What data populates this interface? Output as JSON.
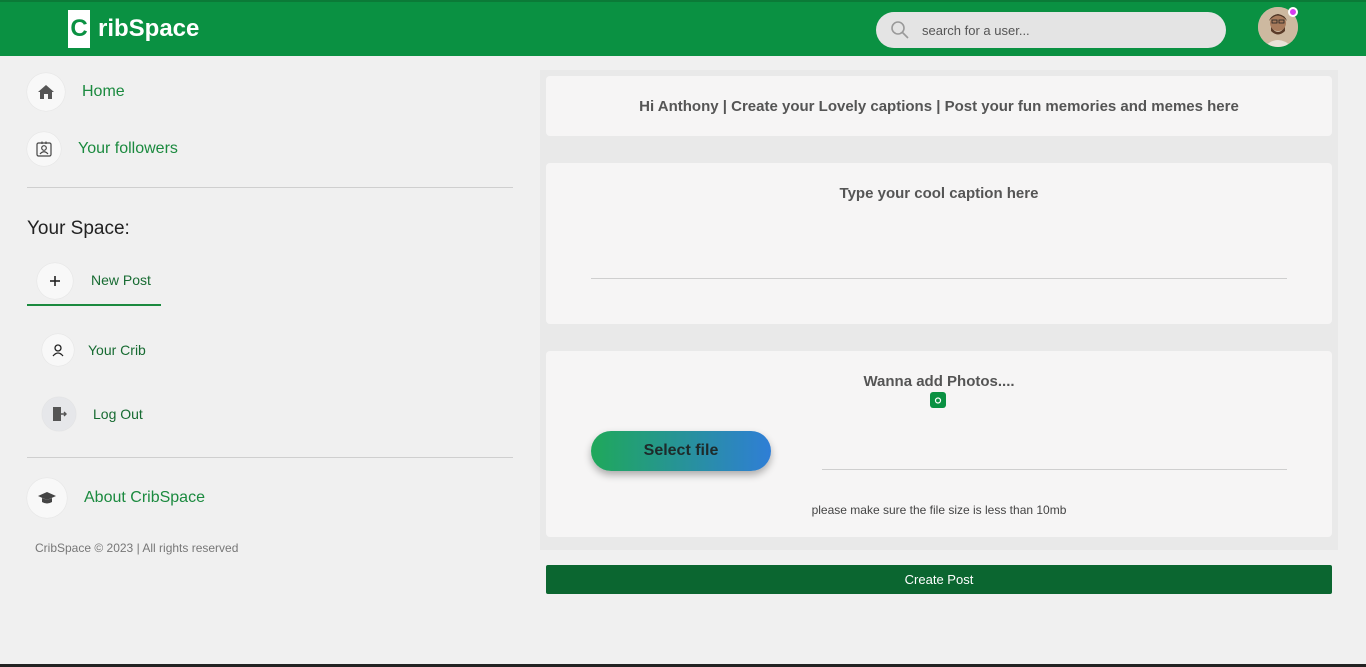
{
  "header": {
    "logo_letter": "C",
    "logo_text": "ribSpace",
    "search_placeholder": "search for a user..."
  },
  "sidebar": {
    "nav": [
      {
        "label": "Home",
        "icon": "home-icon"
      },
      {
        "label": "Your followers",
        "icon": "followers-icon"
      }
    ],
    "section_title": "Your Space:",
    "space_items": [
      {
        "label": "New Post",
        "icon": "plus-icon",
        "active": true
      },
      {
        "label": "Your Crib",
        "icon": "user-icon"
      },
      {
        "label": "Log Out",
        "icon": "logout-icon"
      }
    ],
    "about_label": "About CribSpace",
    "copyright": "CribSpace © 2023 | All rights reserved"
  },
  "main": {
    "greeting": "Hi Anthony | Create your Lovely captions | Post your fun memories and memes here",
    "caption_title": "Type your cool caption here",
    "photos_title": "Wanna add Photos....",
    "select_file_label": "Select file",
    "file_note": "please make sure the file size is less than 10mb",
    "create_post_label": "Create Post"
  },
  "colors": {
    "brand_green": "#0a9142",
    "dark_green": "#0b6630",
    "gradient_start": "#1fa85a",
    "gradient_end": "#2f7ed6",
    "notification_dot": "#d63cf0"
  }
}
